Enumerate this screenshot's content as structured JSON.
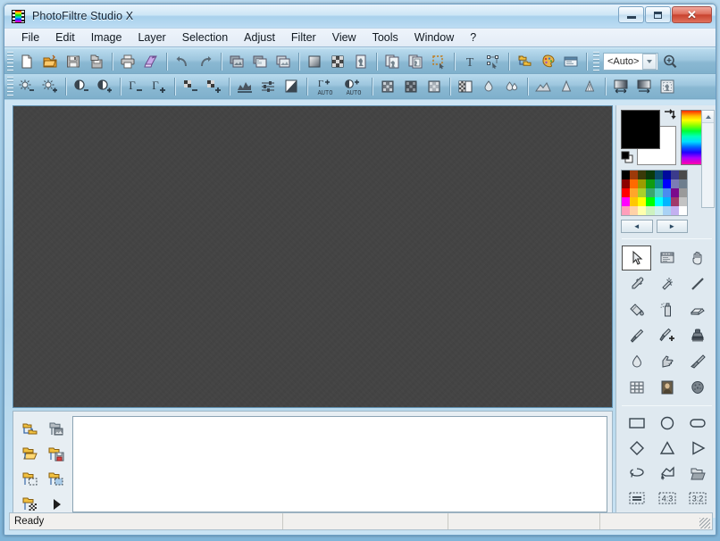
{
  "window": {
    "title": "PhotoFiltre Studio X",
    "app_icon": "filmstrip-icon",
    "buttons": {
      "minimize": "minimize",
      "maximize": "maximize",
      "close": "close"
    }
  },
  "menubar": {
    "items": [
      {
        "label": "File",
        "name": "menu-file"
      },
      {
        "label": "Edit",
        "name": "menu-edit"
      },
      {
        "label": "Image",
        "name": "menu-image"
      },
      {
        "label": "Layer",
        "name": "menu-layer"
      },
      {
        "label": "Selection",
        "name": "menu-selection"
      },
      {
        "label": "Adjust",
        "name": "menu-adjust"
      },
      {
        "label": "Filter",
        "name": "menu-filter"
      },
      {
        "label": "View",
        "name": "menu-view"
      },
      {
        "label": "Tools",
        "name": "menu-tools"
      },
      {
        "label": "Window",
        "name": "menu-window"
      },
      {
        "label": "?",
        "name": "menu-help"
      }
    ]
  },
  "toolbar_main": {
    "groups": [
      [
        "new-document-icon",
        "open-folder-icon",
        "save-icon",
        "save-as-icon"
      ],
      [
        "print-icon",
        "print-preview-icon"
      ],
      [
        "undo-icon",
        "redo-icon"
      ],
      [
        "copy-image-icon",
        "paste-transparent-icon",
        "duplicate-image-icon"
      ],
      [
        "gradient-square-icon",
        "checkerboard-icon",
        "image-effect-icon"
      ],
      [
        "image-copies-icon",
        "image-frame-icon",
        "selection-marquee-icon"
      ],
      [
        "text-tool-icon",
        "vector-node-icon"
      ],
      [
        "layers-manager-icon",
        "palette-icon",
        "preferences-icon"
      ]
    ],
    "zoom": {
      "value": "<Auto>",
      "name": "zoom-combo"
    },
    "zoom_tool": "magnifier-icon"
  },
  "toolbar_adjust": {
    "groups": [
      [
        "brightness-minus-icon",
        "brightness-plus-icon"
      ],
      [
        "contrast-minus-icon",
        "contrast-plus-icon"
      ],
      [
        "gamma-minus-icon",
        "gamma-plus-icon"
      ],
      [
        "saturation-minus-icon",
        "saturation-plus-icon"
      ],
      [
        "histogram-icon",
        "levels-icon",
        "grayscale-icon"
      ],
      [
        "auto-gamma-icon",
        "auto-contrast-icon"
      ],
      [
        "dither-fine-icon",
        "dither-medium-icon",
        "dither-coarse-icon"
      ],
      [
        "transparency-icon",
        "blur-icon",
        "blur-more-icon"
      ],
      [
        "sharpen-icon",
        "sharpen-more-icon",
        "emboss-icon"
      ],
      [
        "hflip-icon",
        "vflip-icon",
        "frame-effect-icon"
      ]
    ]
  },
  "bottom_panel": {
    "buttons": [
      "open-tree-icon",
      "export-image-icon",
      "open-folder-icon",
      "save-folder-icon",
      "folder-selection-icon",
      "folder-mask-icon",
      "folder-checker-icon",
      "play-icon"
    ],
    "list_items": []
  },
  "right_panel": {
    "colors": {
      "foreground": "#000000",
      "background": "#ffffff",
      "swap_icon": "swap-colors-icon",
      "reset_icon": "reset-colors-icon",
      "hue_strip": "hue-gradient-strip"
    },
    "palette": [
      "#000000",
      "#9c3a0a",
      "#3a3a08",
      "#0a3a0a",
      "#0b4a6b",
      "#000a9c",
      "#3b3b8c",
      "#4a4a4a",
      "#8c0000",
      "#ff6a00",
      "#9c9c00",
      "#109c10",
      "#0f8c8c",
      "#0000ff",
      "#7b7bb5",
      "#6e7e8e",
      "#ff0000",
      "#ffa62a",
      "#a8d12a",
      "#3aa86e",
      "#4ecfc4",
      "#4a8cf0",
      "#7b0a8c",
      "#9a9a9a",
      "#ff00ff",
      "#ffc800",
      "#ffff00",
      "#00ff00",
      "#00ffff",
      "#00b5ff",
      "#a03a6b",
      "#c3c3c3",
      "#ff9ebb",
      "#ffd2a8",
      "#ffffae",
      "#cdf2c0",
      "#cfefef",
      "#a8d2f5",
      "#c3b0f0",
      "#ffffff"
    ],
    "palette_nav": {
      "prev": "◄",
      "next": "►"
    },
    "tools": [
      {
        "name": "select-arrow-tool",
        "icon": "arrow-cursor-icon",
        "selected": true
      },
      {
        "name": "image-window-tool",
        "icon": "image-window-icon",
        "selected": false
      },
      {
        "name": "hand-tool",
        "icon": "hand-icon",
        "selected": false
      },
      {
        "name": "eyedropper-tool",
        "icon": "eyedropper-icon",
        "selected": false
      },
      {
        "name": "magic-wand-tool",
        "icon": "magic-wand-icon",
        "selected": false
      },
      {
        "name": "line-tool",
        "icon": "line-icon",
        "selected": false
      },
      {
        "name": "paint-bucket-tool",
        "icon": "paint-bucket-icon",
        "selected": false
      },
      {
        "name": "spray-tool",
        "icon": "spray-can-icon",
        "selected": false
      },
      {
        "name": "eraser-tool",
        "icon": "eraser-icon",
        "selected": false
      },
      {
        "name": "paintbrush-tool",
        "icon": "paintbrush-icon",
        "selected": false
      },
      {
        "name": "advanced-brush-tool",
        "icon": "brush-plus-icon",
        "selected": false
      },
      {
        "name": "stamp-tool",
        "icon": "stamp-icon",
        "selected": false
      },
      {
        "name": "blur-drop-tool",
        "icon": "water-drop-icon",
        "selected": false
      },
      {
        "name": "smudge-tool",
        "icon": "smudge-finger-icon",
        "selected": false
      },
      {
        "name": "broom-tool",
        "icon": "broom-icon",
        "selected": false
      },
      {
        "name": "grid-tool",
        "icon": "grid-icon",
        "selected": false
      },
      {
        "name": "portrait-tool",
        "icon": "portrait-photo-icon",
        "selected": false
      },
      {
        "name": "sponge-tool",
        "icon": "sponge-icon",
        "selected": false
      }
    ],
    "shapes": [
      {
        "name": "rectangle-shape",
        "icon": "rectangle-icon"
      },
      {
        "name": "ellipse-shape",
        "icon": "circle-icon"
      },
      {
        "name": "rounded-rect-shape",
        "icon": "rounded-rectangle-icon"
      },
      {
        "name": "diamond-shape",
        "icon": "diamond-icon"
      },
      {
        "name": "triangle-shape",
        "icon": "triangle-icon"
      },
      {
        "name": "right-triangle-shape",
        "icon": "play-triangle-icon"
      },
      {
        "name": "lasso-shape",
        "icon": "lasso-icon"
      },
      {
        "name": "polygon-shape",
        "icon": "polygon-icon"
      },
      {
        "name": "load-selection",
        "icon": "open-folder-icon"
      },
      {
        "name": "fixed-ratio-shape",
        "icon": "equals-box-icon"
      },
      {
        "name": "ratio-4-3-shape",
        "icon": "ratio-43-icon",
        "label": "4:3"
      },
      {
        "name": "ratio-3-2-shape",
        "icon": "ratio-32-icon",
        "label": "3:2"
      },
      {
        "name": "text-selection-shape",
        "icon": "text-cursor-icon"
      },
      {
        "name": "transform-selection",
        "icon": "transform-handles-icon"
      },
      {
        "name": "selection-options",
        "icon": "options-panel-icon"
      }
    ]
  },
  "statusbar": {
    "message": "Ready",
    "cells": [
      "",
      "",
      ""
    ]
  }
}
